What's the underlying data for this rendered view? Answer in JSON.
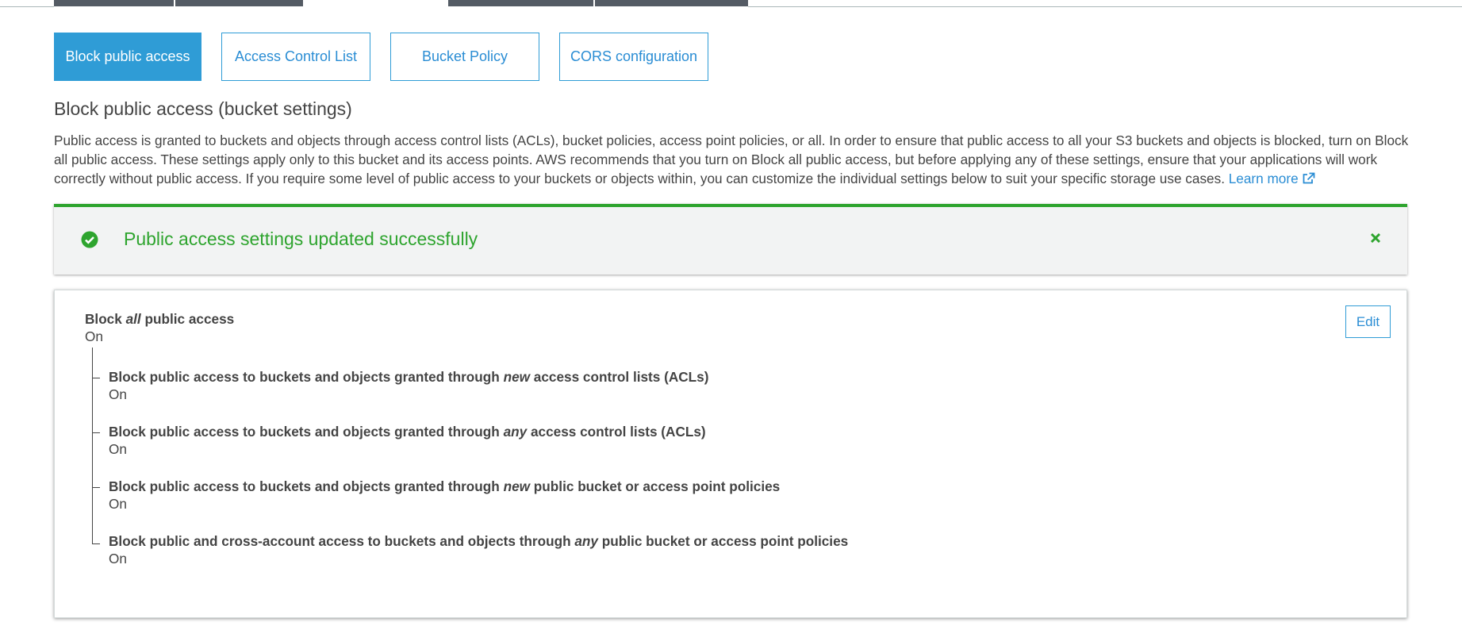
{
  "colors": {
    "accent": "#2f9cd6",
    "link": "#2a8dd4",
    "success": "#2ea42e",
    "text": "#444444",
    "top_tabs": "#545b64"
  },
  "tabs": [
    {
      "label": "Block public access",
      "active": true
    },
    {
      "label": "Access Control List",
      "active": false
    },
    {
      "label": "Bucket Policy",
      "active": false
    },
    {
      "label": "CORS configuration",
      "active": false
    }
  ],
  "section": {
    "title": "Block public access (bucket settings)",
    "description": "Public access is granted to buckets and objects through access control lists (ACLs), bucket policies, access point policies, or all. In order to ensure that public access to all your S3 buckets and objects is blocked, turn on Block all public access. These settings apply only to this bucket and its access points. AWS recommends that you turn on Block all public access, but before applying any of these settings, ensure that your applications will work correctly without public access. If you require some level of public access to your buckets or objects within, you can customize the individual settings below to suit your specific storage use cases.",
    "learn_more": "Learn more",
    "external_icon": "external-link-icon"
  },
  "alert": {
    "message": "Public access settings updated successfully",
    "icon": "check-circle-icon",
    "close_icon": "close-icon"
  },
  "settings": {
    "edit_label": "Edit",
    "main": {
      "pre": "Block ",
      "em": "all",
      "post": " public access",
      "value": "On"
    },
    "items": [
      {
        "pre": "Block public access to buckets and objects granted through ",
        "em": "new",
        "post": " access control lists (ACLs)",
        "value": "On"
      },
      {
        "pre": "Block public access to buckets and objects granted through ",
        "em": "any",
        "post": " access control lists (ACLs)",
        "value": "On"
      },
      {
        "pre": "Block public access to buckets and objects granted through ",
        "em": "new",
        "post": " public bucket or access point policies",
        "value": "On"
      },
      {
        "pre": "Block public and cross-account access to buckets and objects through ",
        "em": "any",
        "post": " public bucket or access point policies",
        "value": "On"
      }
    ]
  }
}
